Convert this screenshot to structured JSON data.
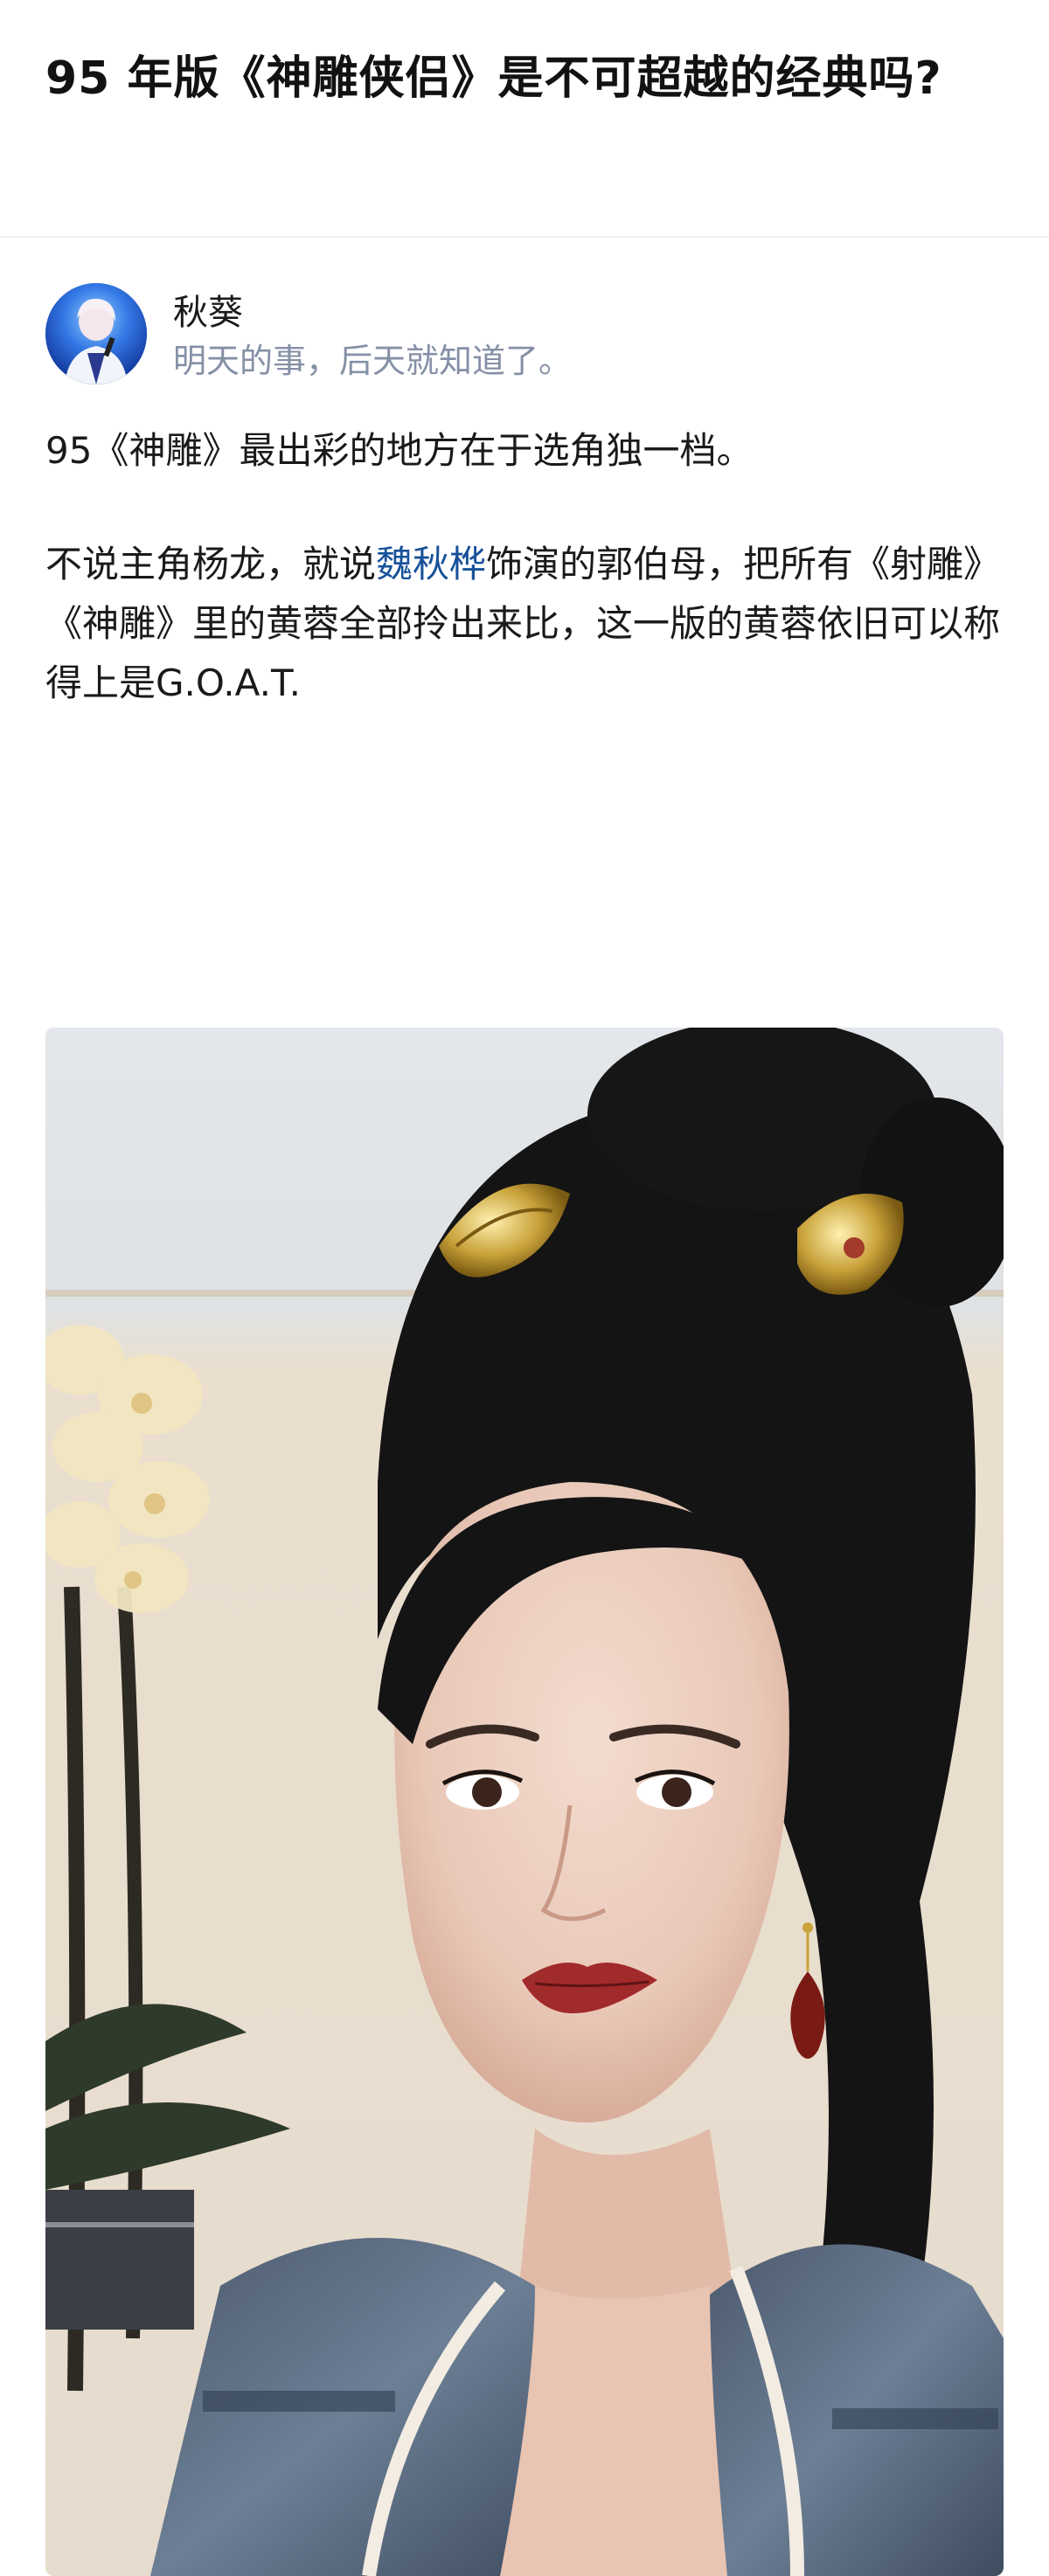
{
  "question": {
    "title": "95 年版《神雕侠侣》是不可超越的经典吗?"
  },
  "answer": {
    "author": {
      "name": "秋葵",
      "bio": "明天的事，后天就知道了。",
      "avatar_icon": "user-avatar"
    },
    "paragraph_1": "95《神雕》最出彩的地方在于选角独一档。",
    "paragraph_2": {
      "before_link": "不说主角杨龙，就说",
      "link_text": "魏秋桦",
      "after_link": "饰演的郭伯母，把所有《射雕》《神雕》里的黄蓉全部拎出来比，这一版的黄蓉依旧可以称得上是G.O.A.T."
    },
    "link_color": "#175199",
    "photo": {
      "subject": "costume-drama-actress-portrait"
    }
  }
}
